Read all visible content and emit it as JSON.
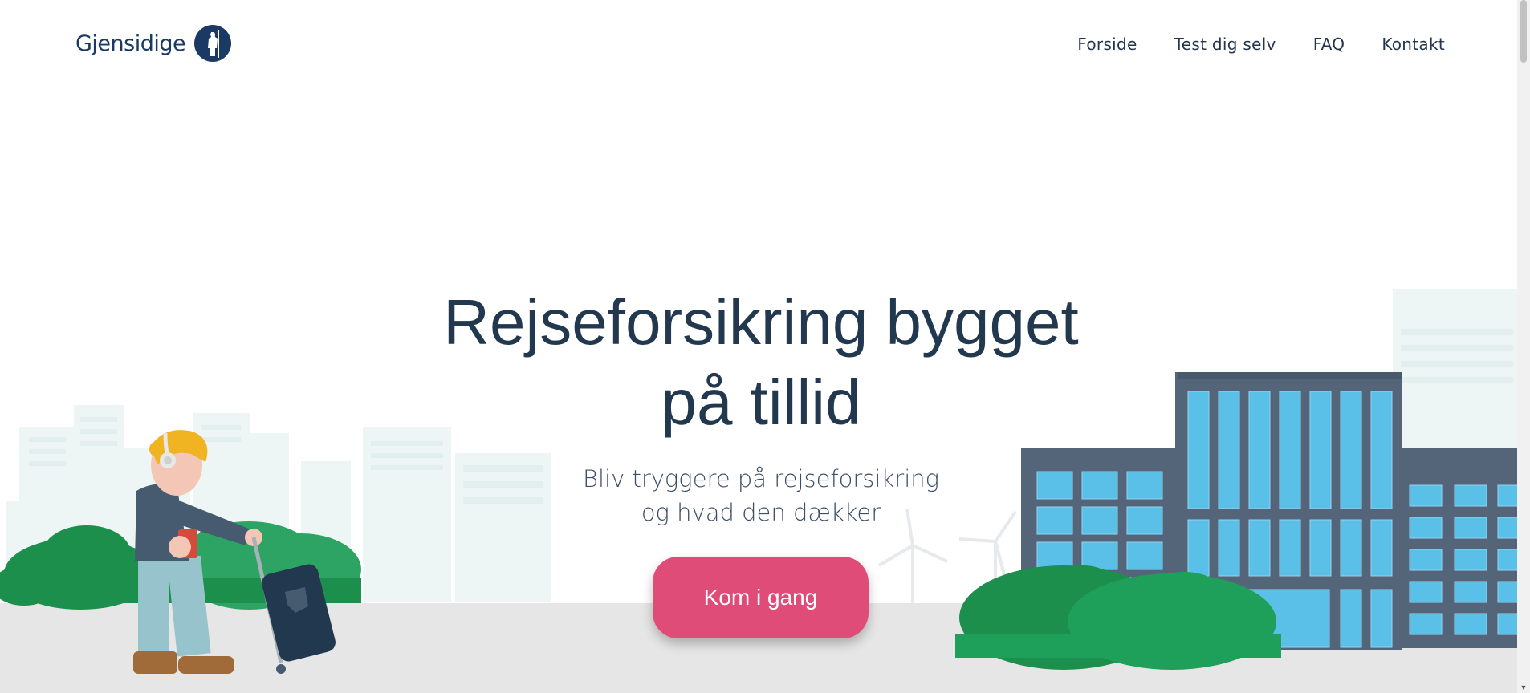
{
  "brand": {
    "name": "Gjensidige"
  },
  "nav": {
    "items": [
      {
        "label": "Forside"
      },
      {
        "label": "Test dig selv"
      },
      {
        "label": "FAQ"
      },
      {
        "label": "Kontakt"
      }
    ]
  },
  "hero": {
    "title_line1": "Rejseforsikring bygget",
    "title_line2": "på tillid",
    "subtitle_line1": "Bliv tryggere på rejseforsikring",
    "subtitle_line2": "og hvad den dækker",
    "cta_label": "Kom i gang"
  },
  "colors": {
    "primary_text": "#22384f",
    "cta": "#e04c78",
    "logo_blue": "#1b3a63",
    "ground": "#e6e6e6",
    "bush": "#1fa05a",
    "building_frame": "#556579",
    "window": "#5bc0e8"
  },
  "icons": {
    "logo_mark": "knight-emblem-icon",
    "scroll_down": "chevron-down-icon"
  }
}
